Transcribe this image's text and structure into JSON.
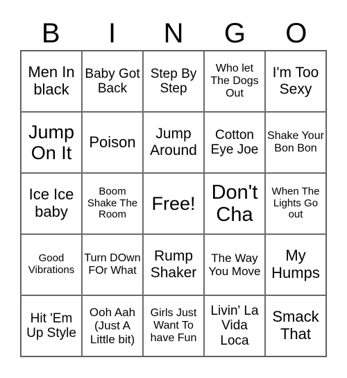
{
  "header": [
    "B",
    "I",
    "N",
    "G",
    "O"
  ],
  "cells": [
    "Men In black",
    "Baby Got Back",
    "Step By Step",
    "Who let The Dogs Out",
    "I'm Too Sexy",
    "Jump On It",
    "Poison",
    "Jump Around",
    "Cotton Eye Joe",
    "Shake Your Bon Bon",
    "Ice Ice baby",
    "Boom Shake The Room",
    "Free!",
    "Don't Cha",
    "When The Lights Go out",
    "Good Vibrations",
    "Turn DOwn FOr What",
    "Rump Shaker",
    "The Way You Move",
    "My Humps",
    "Hit 'Em Up Style",
    "Ooh Aah (Just A Little bit)",
    "Girls Just Want To have Fun",
    "Livin' La Vida Loca",
    "Smack That"
  ]
}
